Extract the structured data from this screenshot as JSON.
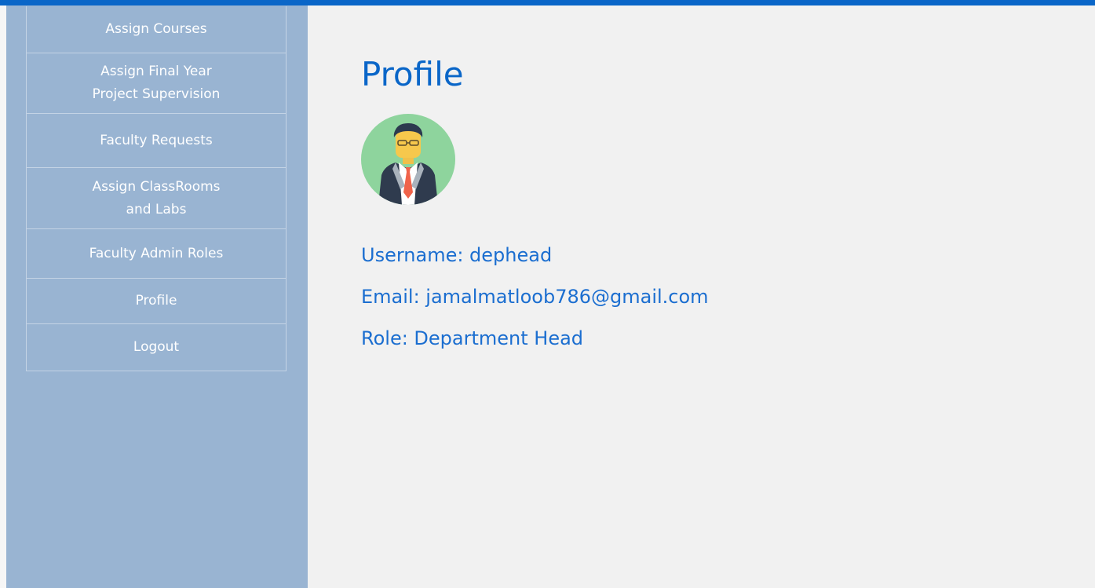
{
  "sidebar": {
    "items": [
      {
        "label": "Assign Courses"
      },
      {
        "label": "Assign Final Year\nProject Supervision"
      },
      {
        "label": "Faculty Requests"
      },
      {
        "label": "Assign ClassRooms\nand Labs"
      },
      {
        "label": "Faculty Admin Roles"
      },
      {
        "label": "Profile"
      },
      {
        "label": "Logout"
      }
    ]
  },
  "main": {
    "title": "Profile",
    "avatar_icon": "businessman-avatar-icon",
    "username": "Username: dephead",
    "email": "Email: jamalmatloob786@gmail.com",
    "role": "Role: Department Head"
  },
  "colors": {
    "top_bar": "#0a66c8",
    "sidebar_bg": "#99b4d2",
    "content_bg": "#f1f1f1",
    "title_text": "#0a66c8",
    "info_text": "#1b6ed0",
    "avatar_bg": "#8ed49d"
  }
}
